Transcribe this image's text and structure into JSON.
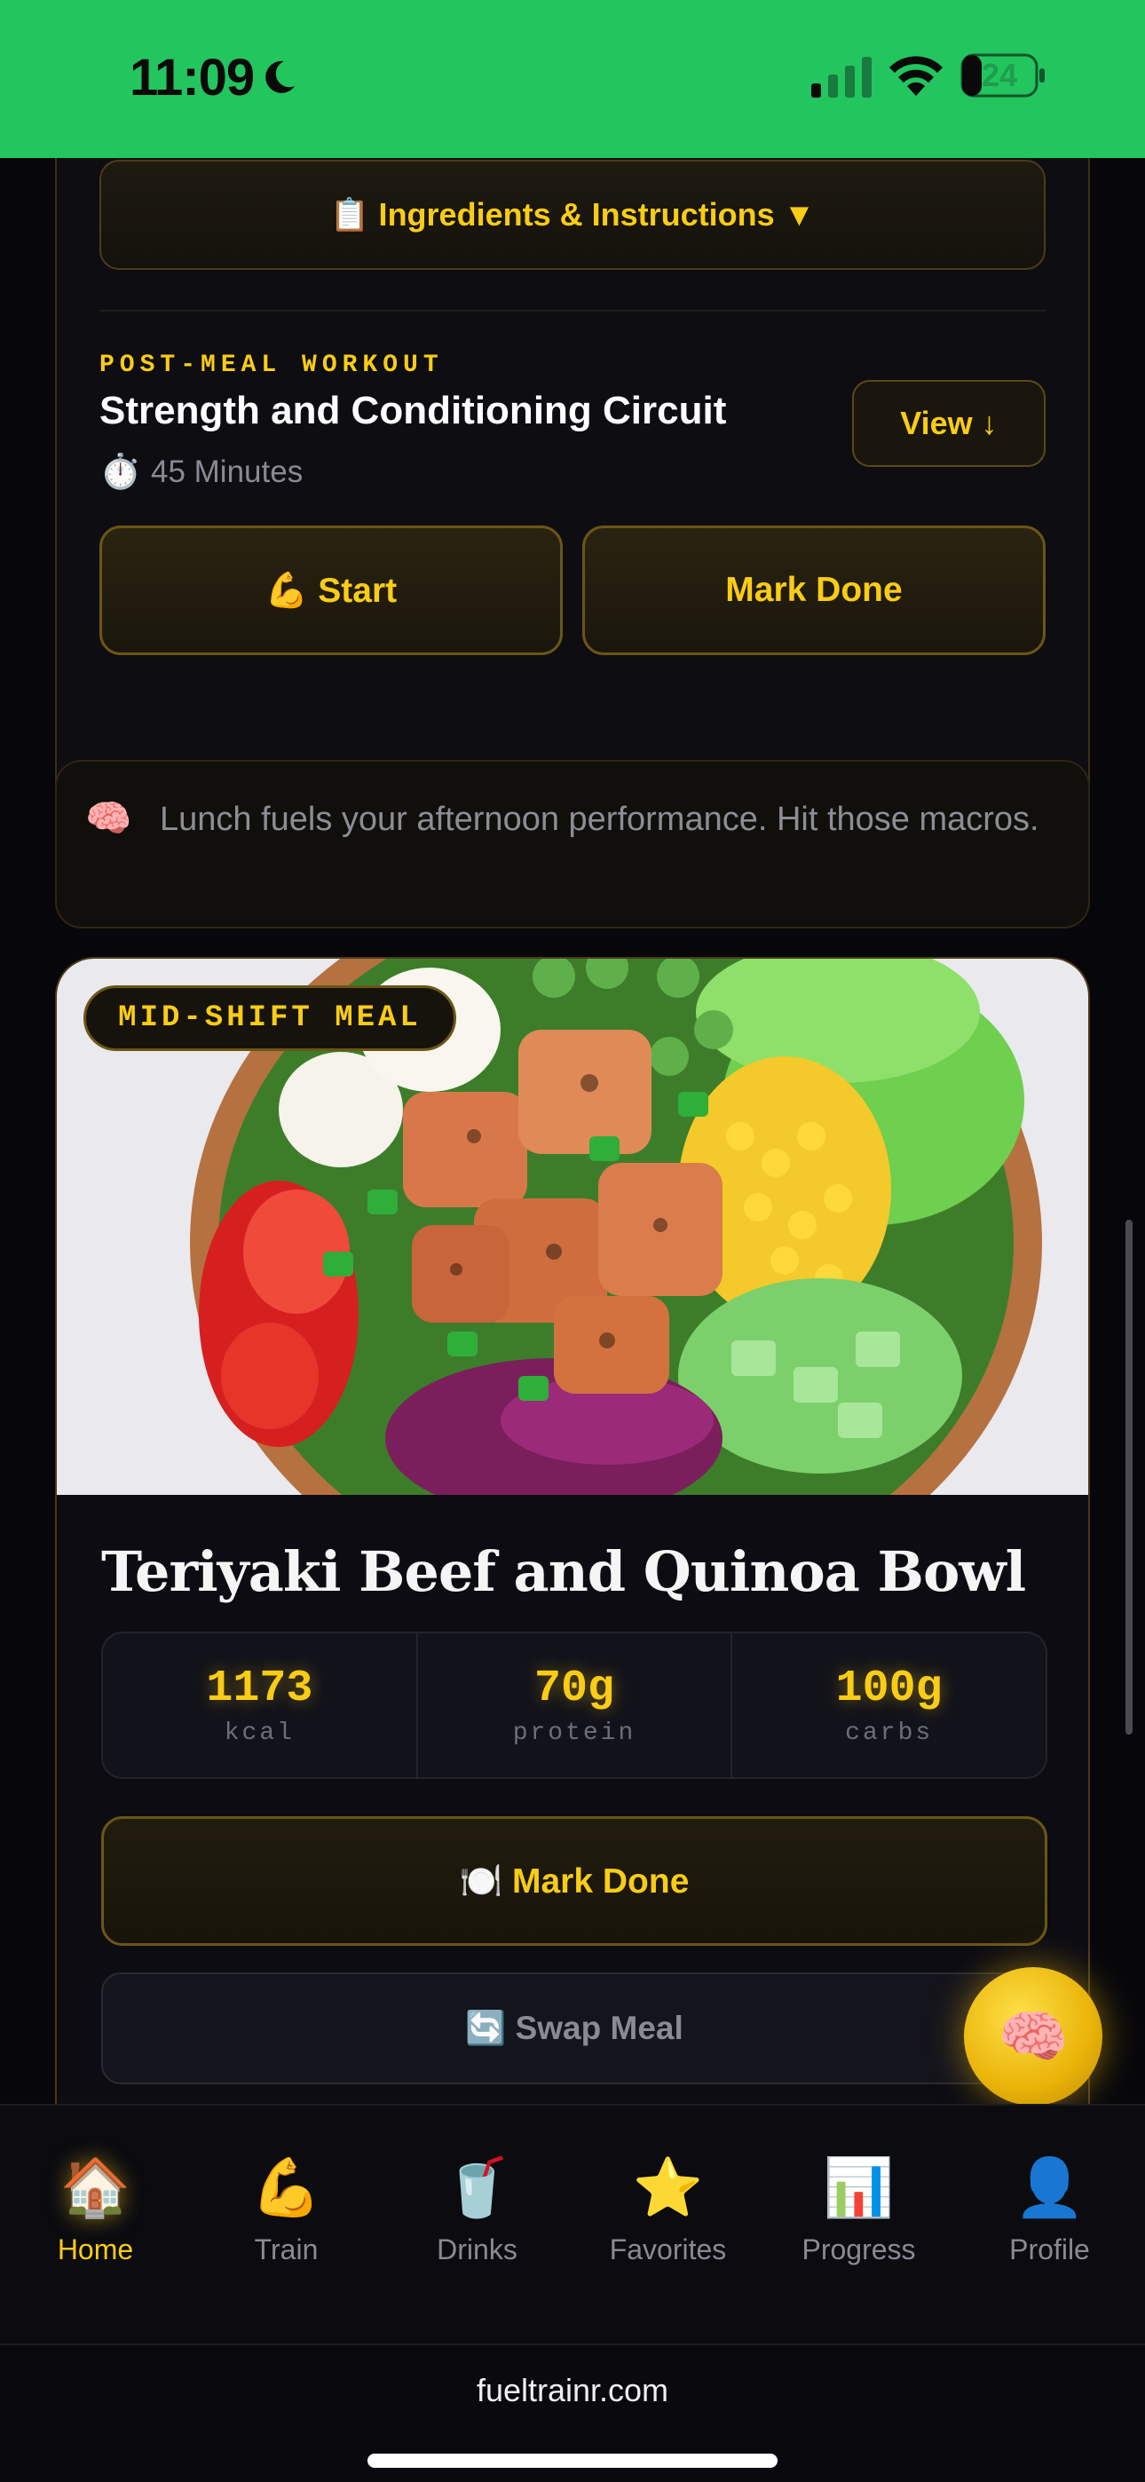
{
  "status_bar": {
    "time": "11:09",
    "battery": "24",
    "background_color": "#22c55e"
  },
  "workout_card": {
    "ingredients_label": "📋 Ingredients & Instructions ▼",
    "kicker": "POST-MEAL WORKOUT",
    "title": "Strength and Conditioning Circuit",
    "timer_icon": "⏱️",
    "duration": "45 Minutes",
    "view_label": "View ↓",
    "start_label": "💪 Start",
    "mark_done_label": "Mark Done"
  },
  "tip": {
    "icon": "🧠",
    "text": "Lunch fuels your afternoon performance. Hit those macros."
  },
  "meal_card": {
    "badge": "MID-SHIFT MEAL",
    "title": "Teriyaki Beef and Quinoa Bowl",
    "macros": [
      {
        "value": "1173",
        "label": "kcal"
      },
      {
        "value": "70g",
        "label": "protein"
      },
      {
        "value": "100g",
        "label": "carbs"
      }
    ],
    "mark_done_label": "🍽️ Mark Done",
    "swap_label": "🔄 Swap Meal"
  },
  "fab_icon": "🧠",
  "nav": {
    "items": [
      {
        "icon": "🏠",
        "label": "Home",
        "active": true
      },
      {
        "icon": "💪",
        "label": "Train"
      },
      {
        "icon": "🥤",
        "label": "Drinks"
      },
      {
        "icon": "⭐",
        "label": "Favorites"
      },
      {
        "icon": "📊",
        "label": "Progress"
      },
      {
        "icon": "👤",
        "label": "Profile"
      }
    ]
  },
  "browser": {
    "url": "fueltrainr.com"
  },
  "colors": {
    "accent": "#facc15",
    "background": "#07070b",
    "muted_text": "#8a8a96"
  }
}
